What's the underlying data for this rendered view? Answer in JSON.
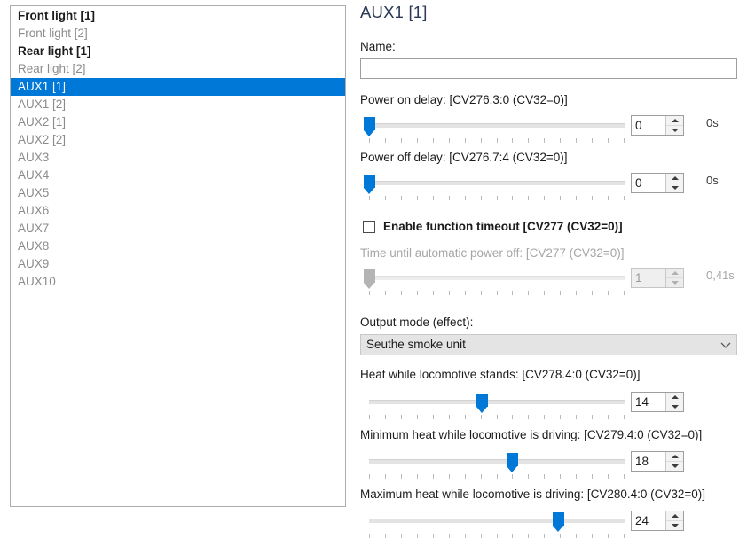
{
  "window": {
    "title": "AUX1 [1]"
  },
  "function_list": {
    "items": [
      {
        "label": "Front light [1]",
        "state": "active"
      },
      {
        "label": "Front light [2]",
        "state": "normal"
      },
      {
        "label": "Rear light [1]",
        "state": "active"
      },
      {
        "label": "Rear light [2]",
        "state": "normal"
      },
      {
        "label": "AUX1 [1]",
        "state": "selected"
      },
      {
        "label": "AUX1 [2]",
        "state": "normal"
      },
      {
        "label": "AUX2 [1]",
        "state": "normal"
      },
      {
        "label": "AUX2 [2]",
        "state": "normal"
      },
      {
        "label": "AUX3",
        "state": "normal"
      },
      {
        "label": "AUX4",
        "state": "normal"
      },
      {
        "label": "AUX5",
        "state": "normal"
      },
      {
        "label": "AUX6",
        "state": "normal"
      },
      {
        "label": "AUX7",
        "state": "normal"
      },
      {
        "label": "AUX8",
        "state": "normal"
      },
      {
        "label": "AUX9",
        "state": "normal"
      },
      {
        "label": "AUX10",
        "state": "normal"
      }
    ]
  },
  "details": {
    "name_label": "Name:",
    "name_value": "",
    "name_placeholder": "",
    "power_on_delay": {
      "label": "Power on delay: [CV276.3:0 (CV32=0)]",
      "value": "0",
      "unit": "0s",
      "percent": 0,
      "ticks": 17,
      "disabled": false
    },
    "power_off_delay": {
      "label": "Power off delay: [CV276.7:4 (CV32=0)]",
      "value": "0",
      "unit": "0s",
      "percent": 0,
      "ticks": 17,
      "disabled": false
    },
    "enable_function_timeout": {
      "label": "Enable function timeout [CV277 (CV32=0)]",
      "checked": false
    },
    "auto_power_off": {
      "label": "Time until automatic power off: [CV277 (CV32=0)]",
      "value": "1",
      "unit": "0,41s",
      "percent": 0,
      "ticks": 17,
      "disabled": true
    },
    "output_mode": {
      "label": "Output mode (effect):",
      "selected": "Seuthe smoke unit",
      "arrow_icon": "chevron-down-icon"
    },
    "heat_stands": {
      "label": "Heat while locomotive stands: [CV278.4:0 (CV32=0)]",
      "value": "14",
      "unit": "",
      "percent": 44,
      "ticks": 17,
      "disabled": false
    },
    "heat_min_driving": {
      "label": "Minimum heat while locomotive is driving: [CV279.4:0 (CV32=0)]",
      "value": "18",
      "unit": "",
      "percent": 56,
      "ticks": 17,
      "disabled": false
    },
    "heat_max_driving": {
      "label": "Maximum heat while locomotive is driving: [CV280.4:0 (CV32=0)]",
      "value": "24",
      "unit": "",
      "percent": 74,
      "ticks": 17,
      "disabled": false
    }
  },
  "colors": {
    "accent": "#0078d7",
    "title": "#2b3a55",
    "disabled_text": "#a6a6a6"
  }
}
